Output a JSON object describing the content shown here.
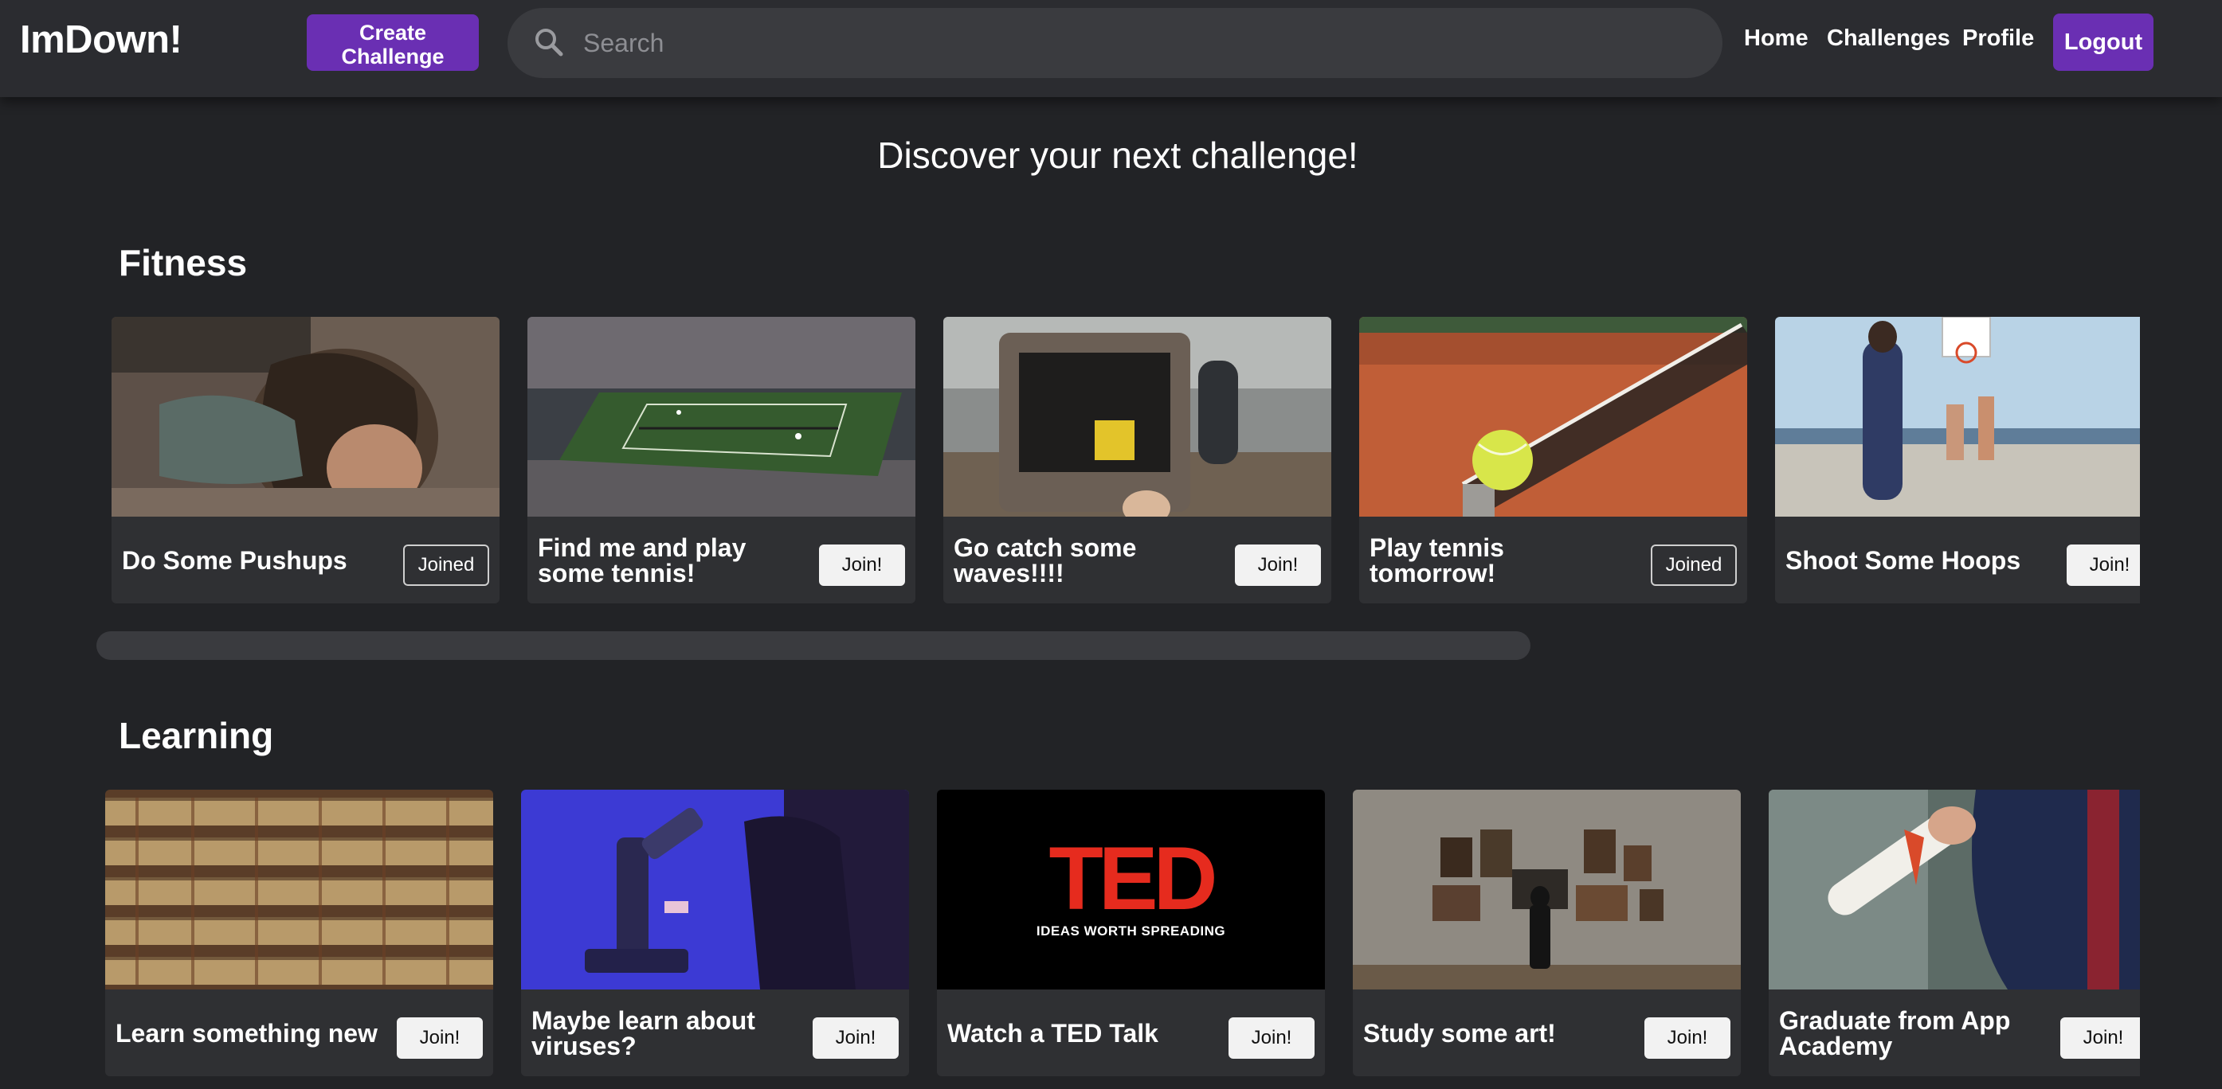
{
  "app": {
    "logo": "ImDown!"
  },
  "header": {
    "create_label": "Create Challenge",
    "search_placeholder": "Search",
    "nav": {
      "home": "Home",
      "challenges": "Challenges",
      "profile": "Profile"
    },
    "logout_label": "Logout"
  },
  "main": {
    "title": "Discover your next challenge!",
    "sections": [
      {
        "title": "Fitness",
        "cards": [
          {
            "title": "Do Some Pushups",
            "button": "Joined",
            "image": "woman-doing-pushups"
          },
          {
            "title": "Find me and play some tennis!",
            "button": "Join!",
            "image": "tennis-stadium"
          },
          {
            "title": "Go catch some waves!!!!",
            "button": "Join!",
            "image": "van-at-beach"
          },
          {
            "title": "Play tennis tomorrow!",
            "button": "Joined",
            "image": "tennis-ball-on-net"
          },
          {
            "title": "Shoot Some Hoops",
            "button": "Join!",
            "image": "basketball-court"
          }
        ]
      },
      {
        "title": "Learning",
        "cards": [
          {
            "title": "Learn something new",
            "button": "Join!",
            "image": "bookshelf"
          },
          {
            "title": "Maybe learn about viruses?",
            "button": "Join!",
            "image": "microscope"
          },
          {
            "title": "Watch a TED Talk",
            "button": "Join!",
            "image": "ted-logo"
          },
          {
            "title": "Study some art!",
            "button": "Join!",
            "image": "art-gallery"
          },
          {
            "title": "Graduate from App Academy",
            "button": "Join!",
            "image": "diploma"
          }
        ]
      }
    ]
  },
  "ted": {
    "logo": "TED",
    "tagline": "IDEAS WORTH SPREADING"
  },
  "colors": {
    "accent": "#6a2fb3",
    "background": "#222326",
    "card": "#2f3033",
    "header": "#2b2c30"
  }
}
